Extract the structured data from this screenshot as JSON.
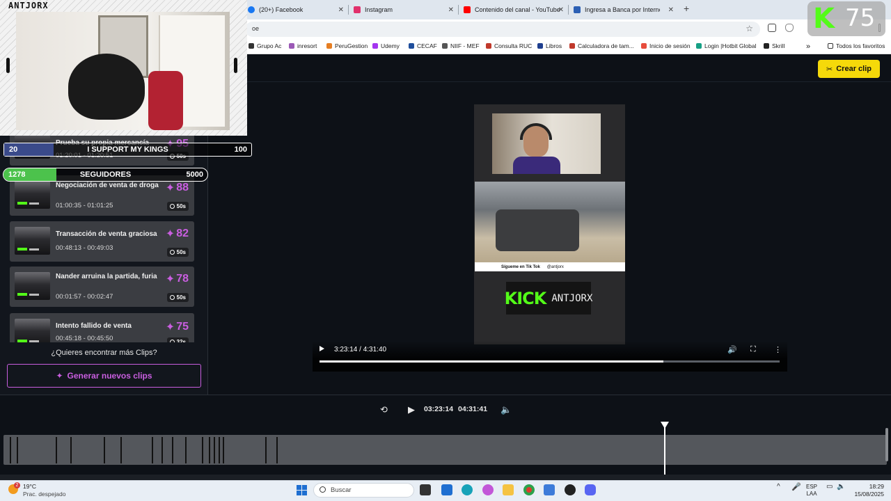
{
  "browser": {
    "tabs": [
      {
        "label": "(20+) Facebook",
        "color": "#1877f2"
      },
      {
        "label": "Instagram",
        "color": "#e1306c"
      },
      {
        "label": "Contenido del canal - YouTube",
        "color": "#ff0000"
      },
      {
        "label": "Ingresa a Banca por Internet BC",
        "color": "#2b5fb4"
      }
    ],
    "new_tab": "+",
    "address": "oe",
    "bookmarks": [
      {
        "label": "Grupo Ac",
        "color": "#333"
      },
      {
        "label": "inresort",
        "color": "#9b59b6"
      },
      {
        "label": "PeruGestion",
        "color": "#e67e22"
      },
      {
        "label": "Udemy",
        "color": "#a435f0"
      },
      {
        "label": "CECAF",
        "color": "#1f4e9c"
      },
      {
        "label": "NIIF - MEF",
        "color": "#555"
      },
      {
        "label": "Consulta RUC",
        "color": "#c0392b"
      },
      {
        "label": "Libros",
        "color": "#1f3f8f"
      },
      {
        "label": "Calculadora de tam...",
        "color": "#c0392b"
      },
      {
        "label": "Inicio de sesión",
        "color": "#e74c3c"
      },
      {
        "label": "Login |Hotbit Global",
        "color": "#16a085"
      },
      {
        "label": "Skrill",
        "color": "#222"
      }
    ],
    "bookmarks_more": "»",
    "all_bookmarks": "Todos los favoritos"
  },
  "header": {
    "create_clip_label": "Crear clip"
  },
  "clips": [
    {
      "title": "Prueba su propia mercancía",
      "time": "01:20:01 - 01:20:51",
      "score": "95",
      "duration": "50s"
    },
    {
      "title": "Negociación de venta de droga",
      "time": "01:00:35 - 01:01:25",
      "score": "88",
      "duration": "50s"
    },
    {
      "title": "Transacción de venta graciosa",
      "time": "00:48:13 - 00:49:03",
      "score": "82",
      "duration": "50s"
    },
    {
      "title": "Nander arruina la partida, furia",
      "time": "00:01:57 - 00:02:47",
      "score": "78",
      "duration": "50s"
    },
    {
      "title": "Intento fallido de venta",
      "time": "00:45:18 - 00:45:50",
      "score": "75",
      "duration": "32s"
    }
  ],
  "find_more": "¿Quieres encontrar más Clips?",
  "generate_label": "Generar nuevos clips",
  "video": {
    "time": "3:23:14 / 4:31:40",
    "progress": 0.748,
    "tiktok_text": "Sígueme en Tik Tok",
    "tiktok_handle": "@antjorx",
    "kick_word": "KICK",
    "kick_name": "ANTJORX"
  },
  "timeline": {
    "current": "03:23:14",
    "total": "04:31:41"
  },
  "overlay": {
    "streamer": "ANTJORX",
    "goal1": {
      "current": "20",
      "label": "I SUPPORT MY KINGS",
      "target": "100",
      "fraction": 0.2
    },
    "goal2": {
      "current": "1278",
      "label": "SEGUIDORES",
      "target": "5000",
      "fraction": 0.26
    },
    "kick_letter": "K",
    "kick_number": "75"
  },
  "taskbar": {
    "weather_temp": "19°C",
    "weather_desc": "Prac. despejado",
    "weather_badge": "2",
    "search_placeholder": "Buscar",
    "lang1": "ESP",
    "lang2": "LAA",
    "time": "18:29",
    "date": "15/08/2025"
  }
}
